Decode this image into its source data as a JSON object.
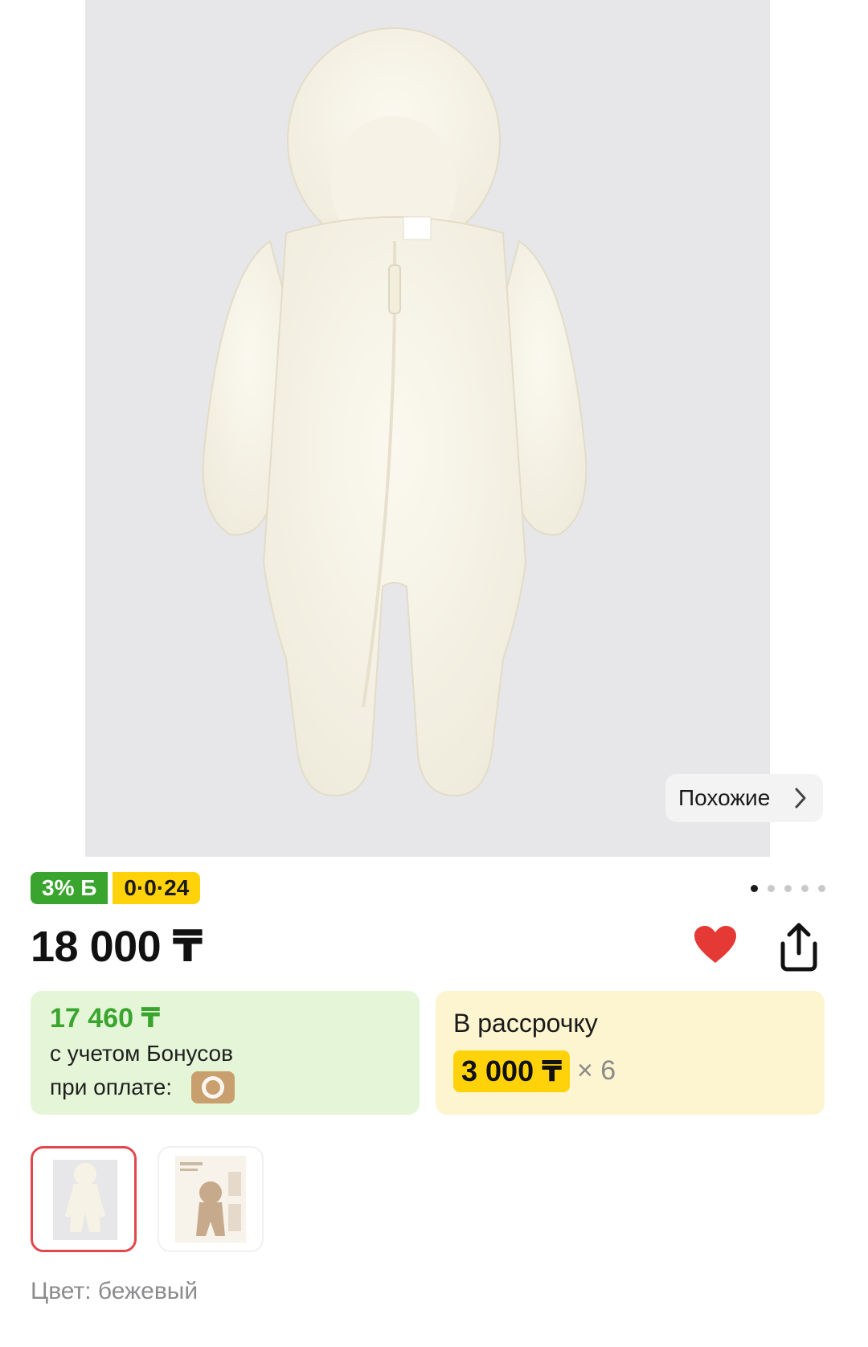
{
  "product": {
    "image_alt": "white fleece baby jumpsuit with bear ears hood",
    "similar_label": "Похожие",
    "badges": {
      "bonus": "3% Б",
      "installment": "0·0·24"
    },
    "gallery_dots": {
      "count": 5,
      "active": 1
    },
    "price": "18 000 ₸",
    "favorite": true,
    "bonus_card": {
      "amount": "17 460 ₸",
      "line1": "с учетом Бонусов",
      "line2": "при оплате:"
    },
    "installment_card": {
      "title": "В рассрочку",
      "monthly": "3 000 ₸",
      "multiplier": "× 6"
    },
    "thumbnails": [
      {
        "selected": true
      },
      {
        "selected": false
      }
    ],
    "color_line": "Цвет: бежевый"
  },
  "colors": {
    "green": "#3aa52e",
    "yellow": "#ffd20a",
    "heart": "#e53935",
    "selected_border": "#e0484d"
  }
}
